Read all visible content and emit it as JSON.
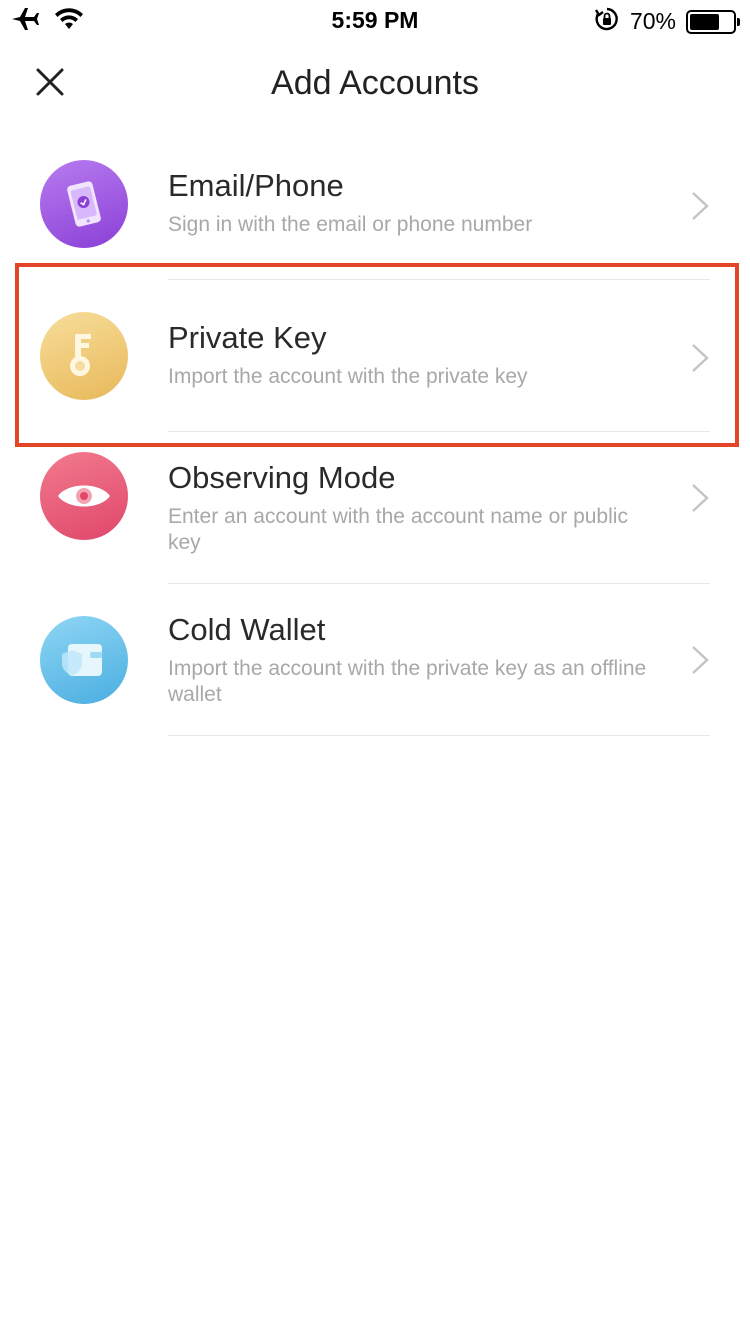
{
  "status_bar": {
    "time": "5:59 PM",
    "battery_percent": "70%",
    "battery_level": 0.7,
    "icons": [
      "airplane-icon",
      "wifi-icon",
      "rotation-lock-icon",
      "battery-icon"
    ]
  },
  "nav": {
    "title": "Add Accounts",
    "close_icon": "close-icon"
  },
  "accounts": [
    {
      "title": "Email/Phone",
      "subtitle": "Sign in with the email or phone number",
      "icon": "phone-icon",
      "color": "#9b55e3"
    },
    {
      "title": "Private Key",
      "subtitle": "Import the account with the private key",
      "icon": "key-icon",
      "color": "#eec46e",
      "highlighted": true
    },
    {
      "title": "Observing Mode",
      "subtitle": "Enter an account with the account name or public key",
      "icon": "eye-icon",
      "color": "#e85b78"
    },
    {
      "title": "Cold Wallet",
      "subtitle": "Import the account with the private key as an offline wallet",
      "icon": "wallet-icon",
      "color": "#62bde9"
    }
  ],
  "highlight_color": "#e44528"
}
